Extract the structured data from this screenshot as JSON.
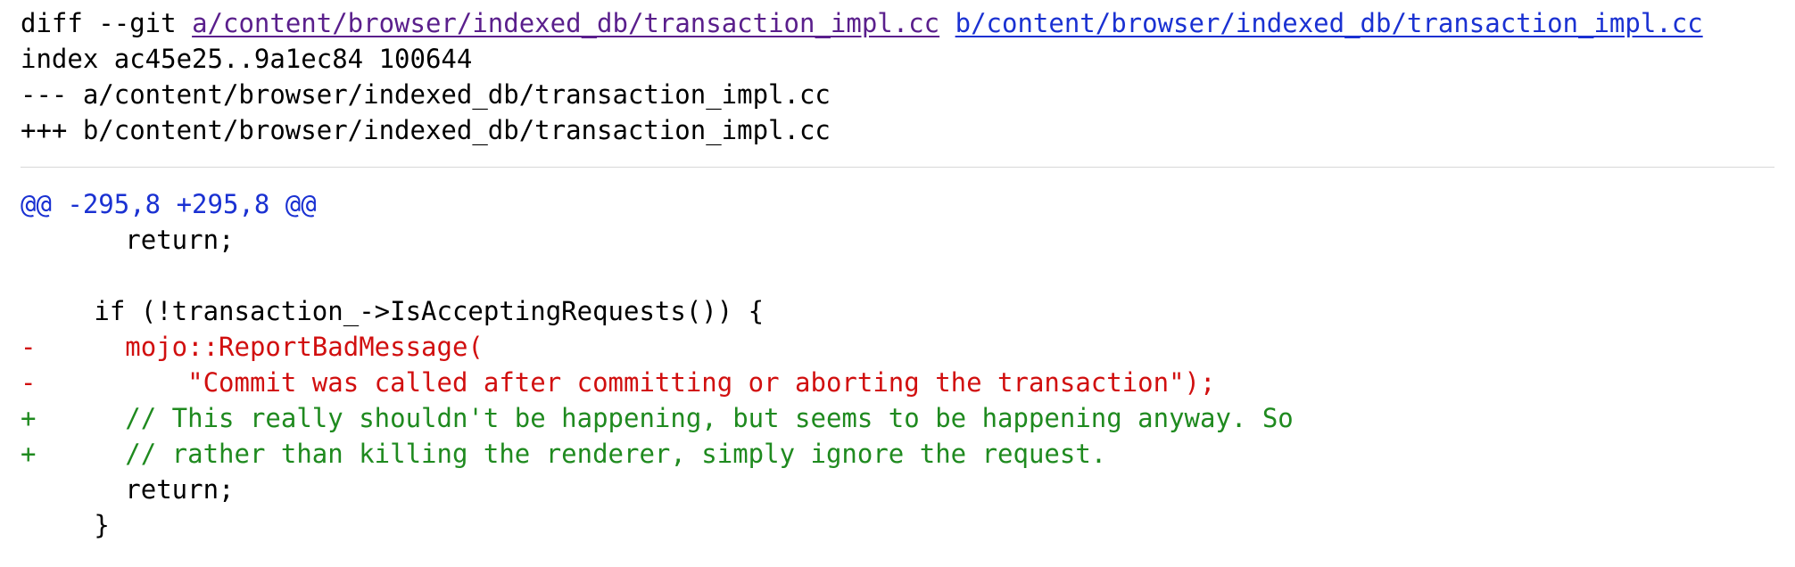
{
  "diff_header": {
    "command": "diff --git",
    "file_a": "a/content/browser/indexed_db/transaction_impl.cc",
    "file_b": "b/content/browser/indexed_db/transaction_impl.cc",
    "index_line": "index ac45e25..9a1ec84 100644",
    "minus_line": "--- a/content/browser/indexed_db/transaction_impl.cc",
    "plus_line": "+++ b/content/browser/indexed_db/transaction_impl.cc"
  },
  "hunk": {
    "header": "@@ -295,8 +295,8 @@",
    "lines": [
      {
        "sign": " ",
        "text": "     return;",
        "kind": "ctx"
      },
      {
        "sign": " ",
        "text": "",
        "kind": "ctx"
      },
      {
        "sign": " ",
        "text": "   if (!transaction_->IsAcceptingRequests()) {",
        "kind": "ctx"
      },
      {
        "sign": "-",
        "text": "     mojo::ReportBadMessage(",
        "kind": "del"
      },
      {
        "sign": "-",
        "text": "         \"Commit was called after committing or aborting the transaction\");",
        "kind": "del"
      },
      {
        "sign": "+",
        "text": "     // This really shouldn't be happening, but seems to be happening anyway. So",
        "kind": "add"
      },
      {
        "sign": "+",
        "text": "     // rather than killing the renderer, simply ignore the request.",
        "kind": "add"
      },
      {
        "sign": " ",
        "text": "     return;",
        "kind": "ctx"
      },
      {
        "sign": " ",
        "text": "   }",
        "kind": "ctx"
      }
    ]
  },
  "colors": {
    "hunk_header": "#1a31d2",
    "deleted": "#d10f0f",
    "added": "#1f8a1f",
    "link_visited": "#5a1f8c",
    "link": "#1a31d2"
  }
}
